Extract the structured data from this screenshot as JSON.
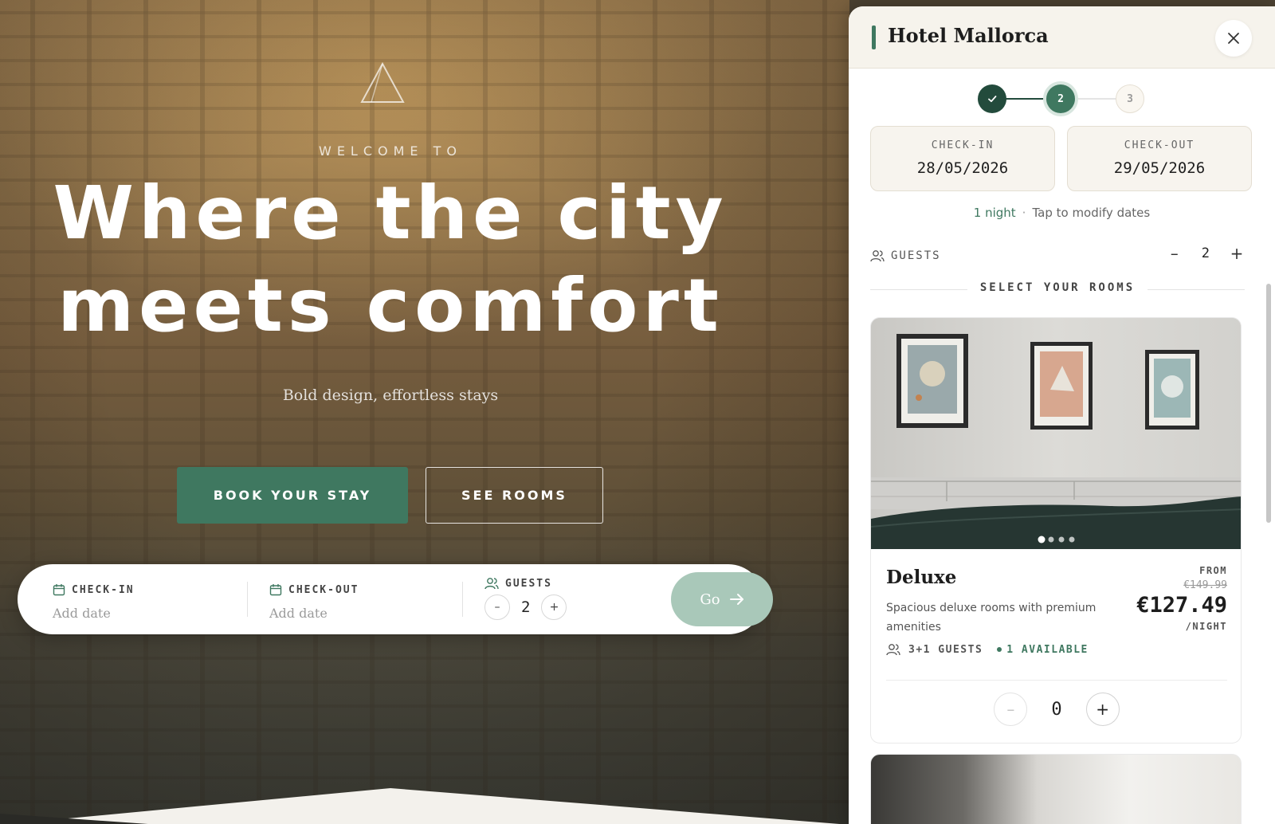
{
  "hero": {
    "welcome": "WELCOME TO",
    "headline_line1": "Where the city",
    "headline_line2": "meets comfort",
    "subtitle": "Bold design, effortless stays",
    "book_button": "BOOK YOUR STAY",
    "rooms_button": "SEE ROOMS"
  },
  "booking_bar": {
    "checkin_label": "CHECK-IN",
    "checkin_value": "Add date",
    "checkout_label": "CHECK-OUT",
    "checkout_value": "Add date",
    "guests_label": "GUESTS",
    "guests_count": "2",
    "minus": "–",
    "plus": "+",
    "go_label": "Go"
  },
  "panel": {
    "title": "Hotel Mallorca",
    "steps": [
      {
        "label": "✓",
        "state": "done"
      },
      {
        "label": "2",
        "state": "active"
      },
      {
        "label": "3",
        "state": "todo"
      }
    ],
    "checkin_label": "CHECK-IN",
    "checkin_date": "28/05/2026",
    "checkout_label": "CHECK-OUT",
    "checkout_date": "29/05/2026",
    "nights": "1 night",
    "modify_hint": "Tap to modify dates",
    "guests_label": "GUESTS",
    "guests_count": "2",
    "guests_minus": "–",
    "guests_plus": "+",
    "section_title": "SELECT YOUR ROOMS",
    "room": {
      "name": "Deluxe",
      "description": "Spacious deluxe rooms with premium amenities",
      "price_from": "FROM",
      "price_old": "€149.99",
      "price_now": "€127.49",
      "price_unit": "/NIGHT",
      "capacity": "3+1 GUESTS",
      "availability": "1 AVAILABLE",
      "quantity": "0",
      "minus": "–",
      "plus": "+",
      "photo_count": 4,
      "photo_index": 1
    }
  },
  "colors": {
    "brand_green": "#3f7860",
    "dark_green": "#234b3c",
    "go_button": "#a9c8b9",
    "panel_header": "#f6f3ec"
  },
  "icons": [
    "triangle-logo-icon",
    "calendar-icon",
    "users-icon",
    "arrow-right-icon",
    "close-icon",
    "check-icon"
  ]
}
